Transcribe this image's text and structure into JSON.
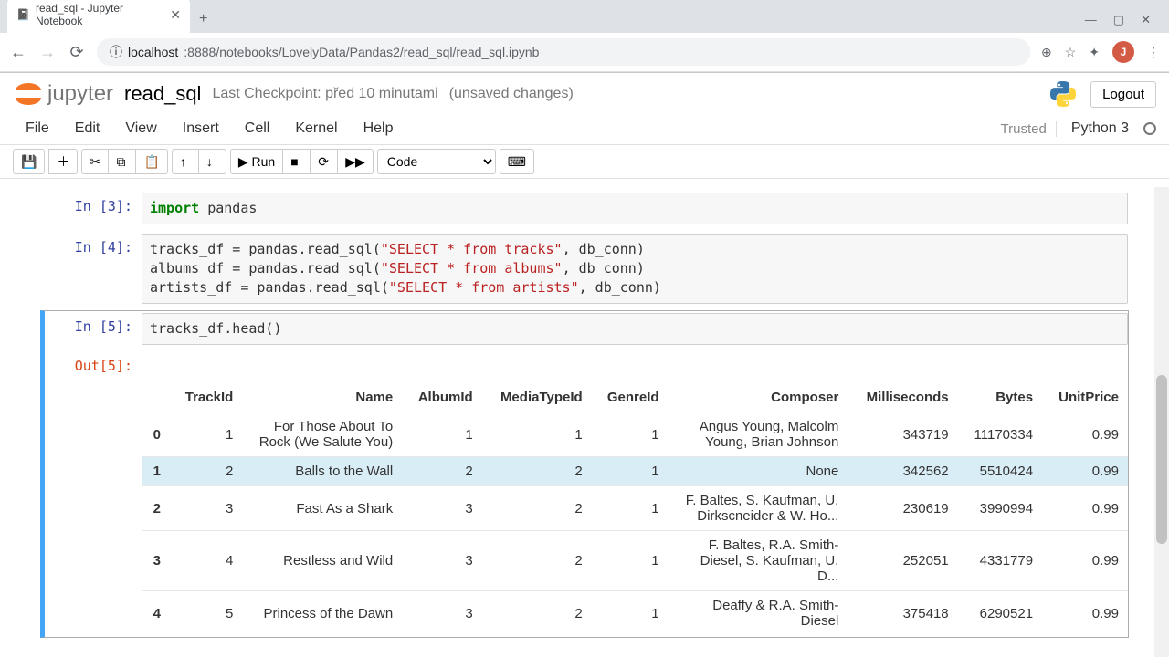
{
  "browser": {
    "tab_title": "read_sql - Jupyter Notebook",
    "new_tab": "+",
    "win_min": "—",
    "win_max": "▢",
    "win_close": "✕",
    "back": "←",
    "forward": "→",
    "reload": "⟳",
    "url_host": "localhost",
    "url_path": ":8888/notebooks/LovelyData/Pandas2/read_sql/read_sql.ipynb",
    "zoom": "⊕",
    "star": "☆",
    "ext": "✦",
    "avatar": "J",
    "menu": "⋮",
    "tab_close": "✕",
    "favicon": "📓",
    "secure": "ⓘ"
  },
  "header": {
    "logo_text": "jupyter",
    "title": "read_sql",
    "checkpoint": "Last Checkpoint: před 10 minutami",
    "unsaved": "(unsaved changes)",
    "logout": "Logout"
  },
  "menu": {
    "items": [
      "File",
      "Edit",
      "View",
      "Insert",
      "Cell",
      "Kernel",
      "Help"
    ],
    "trusted": "Trusted",
    "kernel": "Python 3"
  },
  "toolbar": {
    "save": "💾",
    "add": "＋",
    "cut": "✂",
    "copy": "⧉",
    "paste": "📋",
    "up": "↑",
    "down": "↓",
    "run": "▶ Run",
    "stop": "■",
    "restart": "⟳",
    "fwd": "▶▶",
    "cell_type": "Code",
    "cmd": "⌨"
  },
  "cells": {
    "c3": {
      "prompt": "In [3]:",
      "line1_kw": "import",
      "line1_rest": " pandas"
    },
    "c4": {
      "prompt": "In [4]:",
      "l1a": "tracks_df = pandas.read_sql(",
      "l1b": "\"SELECT * from tracks\"",
      "l1c": ", db_conn)",
      "l2a": "albums_df = pandas.read_sql(",
      "l2b": "\"SELECT * from albums\"",
      "l2c": ", db_conn)",
      "l3a": "artists_df = pandas.read_sql(",
      "l3b": "\"SELECT * from artists\"",
      "l3c": ", db_conn)"
    },
    "c5": {
      "prompt": "In [5]:",
      "code": "tracks_df.head()",
      "out_prompt": "Out[5]:"
    }
  },
  "table": {
    "headers": [
      "",
      "TrackId",
      "Name",
      "AlbumId",
      "MediaTypeId",
      "GenreId",
      "Composer",
      "Milliseconds",
      "Bytes",
      "UnitPrice"
    ],
    "rows": [
      {
        "idx": "0",
        "TrackId": "1",
        "Name": "For Those About To Rock (We Salute You)",
        "AlbumId": "1",
        "MediaTypeId": "1",
        "GenreId": "1",
        "Composer": "Angus Young, Malcolm Young, Brian Johnson",
        "Milliseconds": "343719",
        "Bytes": "11170334",
        "UnitPrice": "0.99"
      },
      {
        "idx": "1",
        "TrackId": "2",
        "Name": "Balls to the Wall",
        "AlbumId": "2",
        "MediaTypeId": "2",
        "GenreId": "1",
        "Composer": "None",
        "Milliseconds": "342562",
        "Bytes": "5510424",
        "UnitPrice": "0.99"
      },
      {
        "idx": "2",
        "TrackId": "3",
        "Name": "Fast As a Shark",
        "AlbumId": "3",
        "MediaTypeId": "2",
        "GenreId": "1",
        "Composer": "F. Baltes, S. Kaufman, U. Dirkscneider & W. Ho...",
        "Milliseconds": "230619",
        "Bytes": "3990994",
        "UnitPrice": "0.99"
      },
      {
        "idx": "3",
        "TrackId": "4",
        "Name": "Restless and Wild",
        "AlbumId": "3",
        "MediaTypeId": "2",
        "GenreId": "1",
        "Composer": "F. Baltes, R.A. Smith-Diesel, S. Kaufman, U. D...",
        "Milliseconds": "252051",
        "Bytes": "4331779",
        "UnitPrice": "0.99"
      },
      {
        "idx": "4",
        "TrackId": "5",
        "Name": "Princess of the Dawn",
        "AlbumId": "3",
        "MediaTypeId": "2",
        "GenreId": "1",
        "Composer": "Deaffy & R.A. Smith-Diesel",
        "Milliseconds": "375418",
        "Bytes": "6290521",
        "UnitPrice": "0.99"
      }
    ]
  }
}
